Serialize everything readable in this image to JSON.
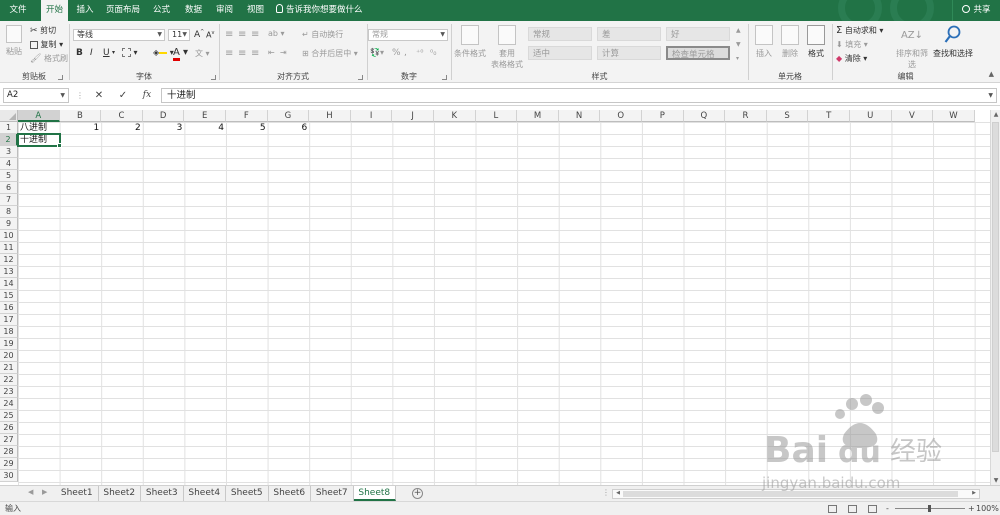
{
  "ribbon_tabs": [
    "文件",
    "开始",
    "插入",
    "页面布局",
    "公式",
    "数据",
    "审阅",
    "视图"
  ],
  "active_tab": "开始",
  "tell_me": "告诉我你想要做什么",
  "share_label": "共享",
  "groups": {
    "clipboard": {
      "label": "剪贴板",
      "paste": "粘贴",
      "cut": "剪切",
      "copy": "复制",
      "format_painter": "格式刷"
    },
    "font": {
      "label": "字体",
      "font_name": "等线",
      "font_size": "11",
      "bold": "B",
      "italic": "I",
      "underline": "U",
      "grow": "A",
      "shrink": "A",
      "color_glyph": "A"
    },
    "alignment": {
      "label": "对齐方式",
      "wrap": "自动换行",
      "merge": "合并后居中"
    },
    "number": {
      "label": "数字",
      "format": "常规",
      "percent": "%",
      "comma": ","
    },
    "styles": {
      "label": "样式",
      "conditional": "条件格式",
      "table_l1": "套用",
      "table_l2": "表格格式",
      "cells": [
        "常规",
        "差",
        "好",
        "适中",
        "计算",
        "检查单元格"
      ]
    },
    "cells_group": {
      "label": "单元格",
      "insert": "插入",
      "delete": "删除",
      "format": "格式"
    },
    "editing": {
      "label": "编辑",
      "autosum": "自动求和",
      "fill": "填充",
      "clear": "清除",
      "sort": "排序和筛选",
      "find": "查找和选择"
    }
  },
  "formula_bar": {
    "name_box": "A2",
    "cancel": "✕",
    "enter": "✓",
    "fx": "fx",
    "content": "十进制"
  },
  "columns": [
    "A",
    "B",
    "C",
    "D",
    "E",
    "F",
    "G",
    "H",
    "I",
    "J",
    "K",
    "L",
    "M",
    "N",
    "O",
    "P",
    "Q",
    "R",
    "S",
    "T",
    "U",
    "V",
    "W"
  ],
  "rows": [
    "1",
    "2",
    "3",
    "4",
    "5",
    "6",
    "7",
    "8",
    "9",
    "10",
    "11",
    "12",
    "13",
    "14",
    "15",
    "16",
    "17",
    "18",
    "19",
    "20",
    "21",
    "22",
    "23",
    "24",
    "25",
    "26",
    "27",
    "28",
    "29",
    "30"
  ],
  "active_cell": {
    "col": "A",
    "row": "2"
  },
  "cells": {
    "A1": "八进制",
    "B1": "1",
    "C1": "2",
    "D1": "3",
    "E1": "4",
    "F1": "5",
    "G1": "6",
    "A2": "十进制"
  },
  "sheets": [
    "Sheet1",
    "Sheet2",
    "Sheet3",
    "Sheet4",
    "Sheet5",
    "Sheet6",
    "Sheet7",
    "Sheet8"
  ],
  "active_sheet": "Sheet8",
  "add_sheet": "+",
  "status": {
    "mode": "输入",
    "zoom": "100%",
    "zoom_minus": "-",
    "zoom_plus": "+"
  },
  "watermark": {
    "brand": "Bai",
    "brand2": "du",
    "text": "经验",
    "url": "jingyan.baidu.com"
  },
  "colors": {
    "accent": "#217346",
    "grid": "#e1e1e1",
    "header_bg": "#f3f3f3"
  }
}
